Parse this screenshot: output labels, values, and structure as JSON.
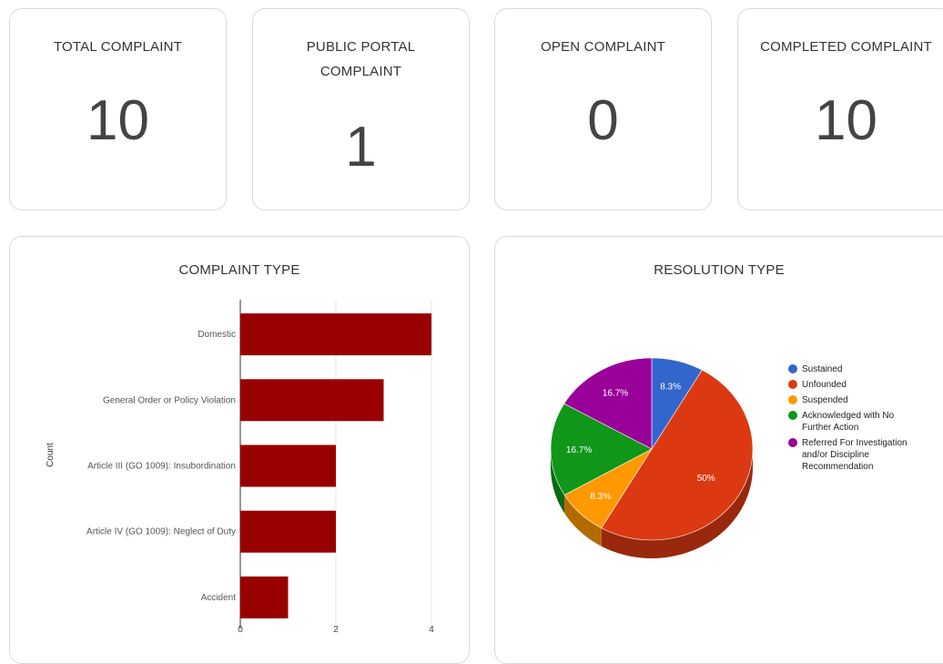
{
  "stats": [
    {
      "title": "TOTAL COMPLAINT",
      "value": "10"
    },
    {
      "title": "PUBLIC PORTAL COMPLAINT",
      "value": "1"
    },
    {
      "title": "OPEN COMPLAINT",
      "value": "0"
    },
    {
      "title": "COMPLETED COMPLAINT",
      "value": "10"
    }
  ],
  "complaint_panel": {
    "title": "COMPLAINT TYPE"
  },
  "resolution_panel": {
    "title": "RESOLUTION TYPE"
  },
  "chart_data": [
    {
      "type": "bar",
      "orientation": "horizontal",
      "title": "COMPLAINT TYPE",
      "ylabel": "Count",
      "categories": [
        "Domestic",
        "General Order or Policy Violation",
        "Article III (GO 1009): Insubordination",
        "Article IV (GO 1009): Neglect of Duty",
        "Accident"
      ],
      "values": [
        4,
        3,
        2,
        2,
        1
      ],
      "xlim": [
        0,
        4
      ],
      "ticks": [
        "0",
        "2",
        "4"
      ],
      "grid": true,
      "color": "#990000"
    },
    {
      "type": "pie",
      "title": "RESOLUTION TYPE",
      "style": "3d",
      "legend_position": "right",
      "slices": [
        {
          "label": "Sustained",
          "value": 8.3,
          "display": "8.3%",
          "color": "#3366cc"
        },
        {
          "label": "Unfounded",
          "value": 50,
          "display": "50%",
          "color": "#dc3912"
        },
        {
          "label": "Suspended",
          "value": 8.3,
          "display": "8.3%",
          "color": "#ff9900"
        },
        {
          "label": "Acknowledged with No Further Action",
          "value": 16.7,
          "display": "16.7%",
          "color": "#109618"
        },
        {
          "label": "Referred For Investigation and/or Discipline Recommendation",
          "value": 16.7,
          "display": "16.7%",
          "color": "#990099"
        }
      ]
    }
  ]
}
